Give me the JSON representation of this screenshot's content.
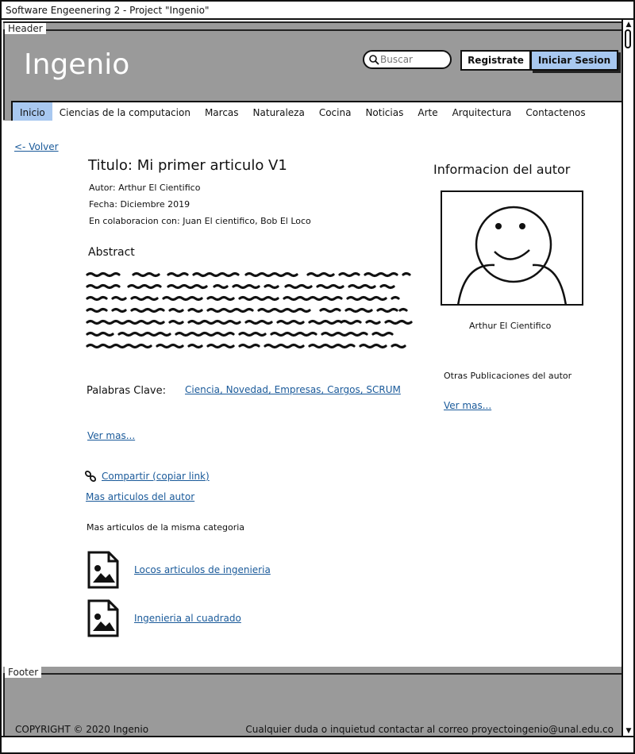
{
  "window": {
    "title": "Software Engeenering 2 - Project  \"Ingenio\""
  },
  "header": {
    "frame_label": "Header",
    "logo": "Ingenio",
    "search_placeholder": "Buscar",
    "register_label": "Registrate",
    "login_label": "Iniciar Sesion"
  },
  "nav": {
    "items": [
      {
        "label": "Inicio"
      },
      {
        "label": "Ciencias de la computacion"
      },
      {
        "label": "Marcas"
      },
      {
        "label": "Naturaleza"
      },
      {
        "label": "Cocina"
      },
      {
        "label": "Noticias"
      },
      {
        "label": "Arte"
      },
      {
        "label": "Arquitectura"
      },
      {
        "label": "Contactenos"
      }
    ],
    "active": "Inicio"
  },
  "article": {
    "back_label": "<- Volver",
    "title": "Titulo: Mi primer articulo V1",
    "author_line": "Autor:    Arthur El Cientifico",
    "date_line": "Fecha: Diciembre 2019",
    "collab_line": "En colaboracion con:  Juan El cientifico,  Bob El Loco",
    "abstract_title": "Abstract",
    "keywords_label": "Palabras Clave:",
    "keywords_value": "Ciencia, Novedad, Empresas, Cargos, SCRUM",
    "ver_mas": "Ver mas...",
    "share_label": "Compartir (copiar link)",
    "more_by_author": "Mas articulos del autor",
    "same_category_title": "Mas articulos de la misma categoria",
    "related": [
      {
        "title": "Locos articulos de ingenieria"
      },
      {
        "title": "Ingenieria al cuadrado"
      }
    ]
  },
  "author": {
    "section_title": "Informacion del autor",
    "name": "Arthur El Cientifico",
    "other_pubs": "Otras Publicaciones del autor",
    "ver_mas": "Ver mas..."
  },
  "footer": {
    "frame_label": "Footer",
    "copyright": "COPYRIGHT © 2020 Ingenio",
    "contact": "Cualquier duda o inquietud contactar al correo proyectoingenio@unal.edu.co"
  },
  "colors": {
    "accent": "#a8c8f0",
    "chrome": "#9a9a9a",
    "link": "#1a5a9a"
  }
}
